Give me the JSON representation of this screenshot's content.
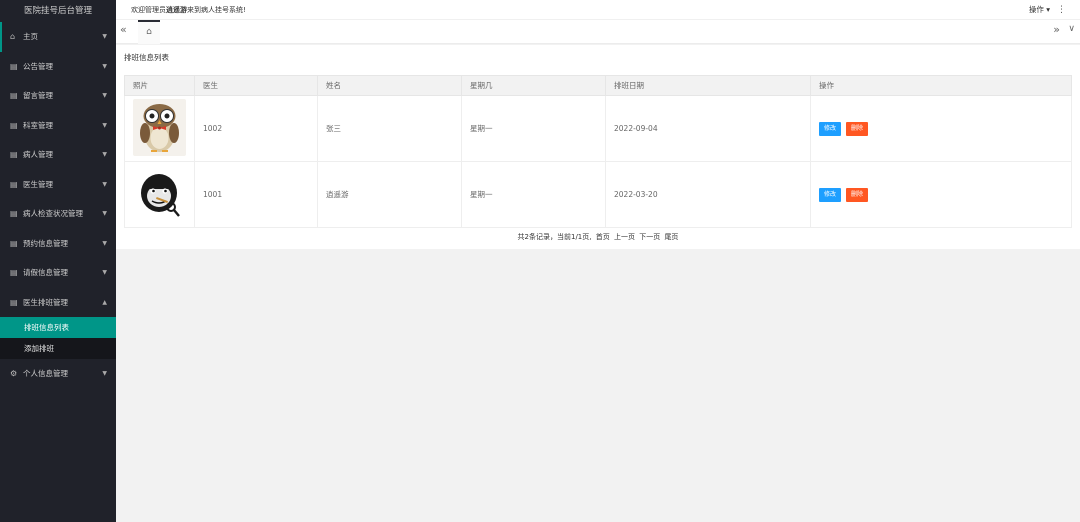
{
  "app": {
    "title": "医院挂号后台管理"
  },
  "header": {
    "welcome_prefix": "欢迎管理员",
    "welcome_user": "逍遥游",
    "welcome_suffix": "来到病人挂号系统!",
    "op_label": "操作"
  },
  "sidebar": {
    "items": [
      {
        "label": "主页",
        "icon": "home-icon"
      },
      {
        "label": "公告管理",
        "icon": "calendar-icon"
      },
      {
        "label": "留言管理",
        "icon": "calendar-icon"
      },
      {
        "label": "科室管理",
        "icon": "calendar-icon"
      },
      {
        "label": "病人管理",
        "icon": "calendar-icon"
      },
      {
        "label": "医生管理",
        "icon": "calendar-icon"
      },
      {
        "label": "病人检查状况管理",
        "icon": "calendar-icon"
      },
      {
        "label": "预约信息管理",
        "icon": "calendar-icon"
      },
      {
        "label": "请假信息管理",
        "icon": "calendar-icon"
      },
      {
        "label": "医生排班管理",
        "icon": "calendar-icon"
      },
      {
        "label": "个人信息管理",
        "icon": "gear-icon"
      }
    ],
    "submenu": [
      {
        "label": "排班信息列表",
        "selected": true
      },
      {
        "label": "添加排班",
        "selected": false
      }
    ]
  },
  "page": {
    "title": "排班信息列表"
  },
  "table": {
    "headers": [
      "照片",
      "医生",
      "姓名",
      "星期几",
      "排班日期",
      "操作"
    ],
    "rows": [
      {
        "photo": "owl-avatar",
        "doctor": "1002",
        "name": "张三",
        "weekday": "星期一",
        "date": "2022-09-04"
      },
      {
        "photo": "gorilla-avatar",
        "doctor": "1001",
        "name": "逍遥游",
        "weekday": "星期一",
        "date": "2022-03-20"
      }
    ],
    "edit_label": "修改",
    "delete_label": "删除"
  },
  "pager": {
    "summary": "共2条记录，当前1/1页,",
    "first": "首页",
    "prev": "上一页",
    "next": "下一页",
    "last": "尾页"
  },
  "colors": {
    "sidebar_bg": "#20222a",
    "accent": "#009688",
    "edit": "#1e9fff",
    "delete": "#ff5722"
  }
}
